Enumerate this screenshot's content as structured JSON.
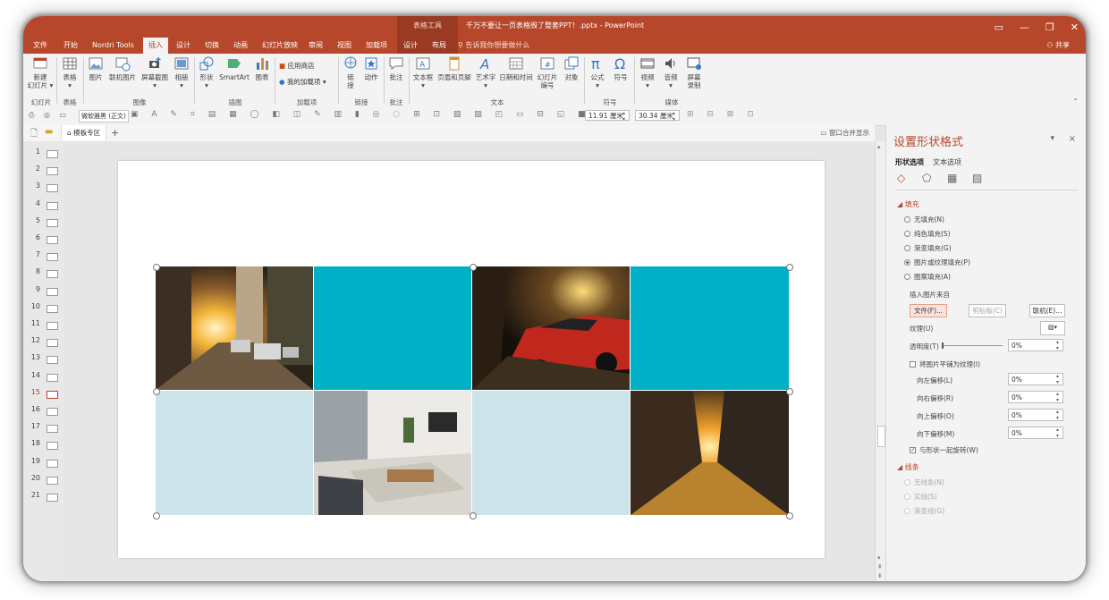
{
  "titlebar": {
    "context_group": "表格工具",
    "doc_title": "千万不要让一页表格毁了整套PPT！.pptx - PowerPoint",
    "ctrl_icons": [
      "ribbon-display-icon",
      "minimize-icon",
      "restore-icon",
      "close-icon"
    ]
  },
  "tabs": [
    {
      "label": "文件"
    },
    {
      "label": "开始"
    },
    {
      "label": "Nordri Tools"
    },
    {
      "label": "插入",
      "active": true
    },
    {
      "label": "设计"
    },
    {
      "label": "切换"
    },
    {
      "label": "动画"
    },
    {
      "label": "幻灯片放映"
    },
    {
      "label": "审阅"
    },
    {
      "label": "视图"
    },
    {
      "label": "加载项"
    },
    {
      "label": "设计"
    },
    {
      "label": "布局"
    }
  ],
  "tellme": "告诉我你想要做什么",
  "share": "共享",
  "ribbon": {
    "buttons": [
      {
        "label": "新建\n幻灯片 ▾",
        "icon": "new-slide-icon"
      },
      {
        "label": "表格\n▾",
        "icon": "table-icon"
      },
      {
        "label": "图片",
        "icon": "picture-icon"
      },
      {
        "label": "联机图片",
        "icon": "online-picture-icon"
      },
      {
        "label": "屏幕截图\n▾",
        "icon": "screenshot-icon"
      },
      {
        "label": "相册\n▾",
        "icon": "album-icon"
      },
      {
        "label": "形状\n▾",
        "icon": "shapes-icon"
      },
      {
        "label": "SmartArt",
        "icon": "smartart-icon"
      },
      {
        "label": "图表",
        "icon": "chart-icon"
      },
      {
        "label": "链\n接",
        "icon": "link-icon"
      },
      {
        "label": "动作",
        "icon": "action-icon"
      },
      {
        "label": "批注",
        "icon": "comment-icon"
      },
      {
        "label": "文本框\n▾",
        "icon": "textbox-icon"
      },
      {
        "label": "页眉和页脚",
        "icon": "header-footer-icon"
      },
      {
        "label": "艺术字\n▾",
        "icon": "wordart-icon"
      },
      {
        "label": "日期和时间",
        "icon": "datetime-icon"
      },
      {
        "label": "幻灯片\n编号",
        "icon": "slide-number-icon"
      },
      {
        "label": "对象",
        "icon": "object-icon"
      },
      {
        "label": "公式\n▾",
        "icon": "equation-icon"
      },
      {
        "label": "符号",
        "icon": "symbol-icon"
      },
      {
        "label": "视频\n▾",
        "icon": "video-icon"
      },
      {
        "label": "音频\n▾",
        "icon": "audio-icon"
      },
      {
        "label": "屏幕\n录制",
        "icon": "screen-record-icon"
      }
    ],
    "addins": {
      "store": "应用商店",
      "my_addins": "我的加载项 ▾"
    },
    "groups": [
      "幻灯片",
      "表格",
      "图像",
      "插图",
      "加载项",
      "链接",
      "批注",
      "文本",
      "符号",
      "媒体"
    ]
  },
  "qat": {
    "font": "微软雅黑 (正文)",
    "height": "11.91 厘米",
    "width": "30.34 厘米",
    "merge_label": "窗口合并显示"
  },
  "doc_tabs": {
    "template_tab": "模板专区",
    "add": "+"
  },
  "slides": [
    "1",
    "2",
    "3",
    "4",
    "5",
    "6",
    "7",
    "8",
    "9",
    "10",
    "11",
    "12",
    "13",
    "14",
    "15",
    "16",
    "17",
    "18",
    "19",
    "20",
    "21"
  ],
  "active_slide": "15",
  "accent_color": "#b7472a",
  "teal": "#00b0c7",
  "lightblue": "#cde3ea",
  "pane": {
    "title": "设置形状格式",
    "close": "×",
    "dropdown": "▾",
    "subtabs": [
      "形状选项",
      "文本选项"
    ],
    "fill_header": "填充",
    "fill_options": [
      {
        "label": "无填充(N)",
        "on": false
      },
      {
        "label": "纯色填充(S)",
        "on": false
      },
      {
        "label": "渐变填充(G)",
        "on": false
      },
      {
        "label": "图片或纹理填充(P)",
        "on": true
      },
      {
        "label": "图案填充(A)",
        "on": false
      }
    ],
    "insert_from": "插入图片来自",
    "btn_file": "文件(F)...",
    "btn_clip": "剪贴板(C)",
    "btn_online": "联机(E)...",
    "texture": "纹理(U)",
    "transparency": "透明度(T)",
    "transparency_val": "0%",
    "tile": "将图片平铺为纹理(I)",
    "offsets": [
      {
        "label": "向左偏移(L)",
        "val": "0%"
      },
      {
        "label": "向右偏移(R)",
        "val": "0%"
      },
      {
        "label": "向上偏移(O)",
        "val": "0%"
      },
      {
        "label": "向下偏移(M)",
        "val": "0%"
      }
    ],
    "rotate": "与形状一起旋转(W)",
    "line_header": "线条",
    "line_options": [
      "无线条(N)",
      "实线(S)",
      "渐变线(G)"
    ]
  }
}
